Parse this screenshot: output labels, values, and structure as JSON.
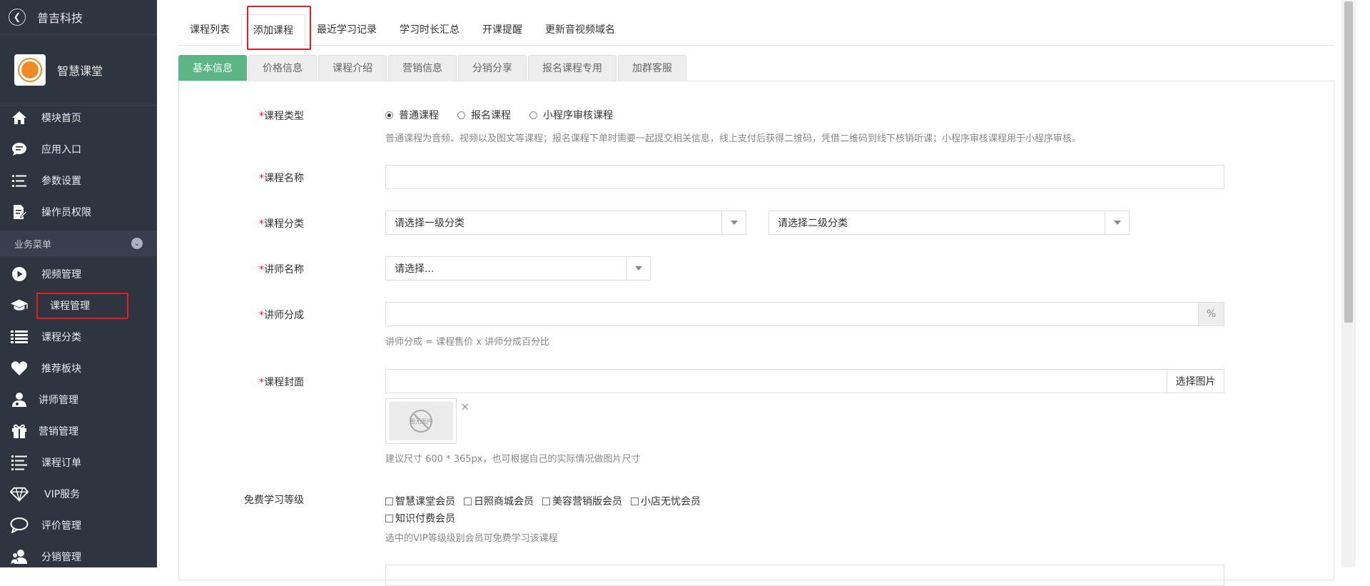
{
  "app": {
    "title": "普吉科技",
    "module_name": "智慧课堂"
  },
  "sidebar": {
    "top_items": [
      {
        "label": "模块首页",
        "icon": "home-icon"
      },
      {
        "label": "应用入口",
        "icon": "chat-icon"
      },
      {
        "label": "参数设置",
        "icon": "list-settings-icon"
      },
      {
        "label": "操作员权限",
        "icon": "edit-doc-icon"
      }
    ],
    "section_label": "业务菜单",
    "business_items": [
      {
        "label": "视频管理",
        "icon": "play-icon"
      },
      {
        "label": "课程管理",
        "icon": "graduation-cap-icon"
      },
      {
        "label": "课程分类",
        "icon": "list-icon"
      },
      {
        "label": "推荐板块",
        "icon": "heart-icon"
      },
      {
        "label": "讲师管理",
        "icon": "teacher-icon"
      },
      {
        "label": "营销管理",
        "icon": "gift-icon"
      },
      {
        "label": "课程订单",
        "icon": "order-list-icon"
      },
      {
        "label": "VIP服务",
        "icon": "diamond-icon"
      },
      {
        "label": "评价管理",
        "icon": "comment-icon"
      },
      {
        "label": "分销管理",
        "icon": "users-icon"
      }
    ],
    "active_item": "课程管理"
  },
  "top_tabs": [
    {
      "label": "课程列表"
    },
    {
      "label": "添加课程"
    },
    {
      "label": "最近学习记录"
    },
    {
      "label": "学习时长汇总"
    },
    {
      "label": "开课提醒"
    },
    {
      "label": "更新音视频域名"
    }
  ],
  "sub_tabs": [
    {
      "label": "基本信息"
    },
    {
      "label": "价格信息"
    },
    {
      "label": "课程介绍"
    },
    {
      "label": "营销信息"
    },
    {
      "label": "分销分享"
    },
    {
      "label": "报名课程专用"
    },
    {
      "label": "加群客服"
    }
  ],
  "form": {
    "required_mark": "*",
    "course_type": {
      "label": "课程类型",
      "options": [
        "普通课程",
        "报名课程",
        "小程序审核课程"
      ],
      "selected": "普通课程",
      "hint": "普通课程为音频、视频以及图文等课程；报名课程下单时需要一起提交相关信息，线上支付后获得二维码，凭借二维码到线下核销听课；小程序审核课程用于小程序审核。"
    },
    "course_name": {
      "label": "课程名称",
      "value": ""
    },
    "category": {
      "label": "课程分类",
      "first_placeholder": "请选择一级分类",
      "second_placeholder": "请选择二级分类"
    },
    "teacher": {
      "label": "讲师名称",
      "placeholder": "请选择..."
    },
    "teacher_share": {
      "label": "讲师分成",
      "value": "",
      "unit": "%",
      "hint": "讲师分成 = 课程售价 x 讲师分成百分比"
    },
    "cover": {
      "label": "课程封面",
      "value": "",
      "button": "选择图片",
      "no_image_text": "暂无图片",
      "remove": "×",
      "hint": "建议尺寸 600 * 365px，也可根据自己的实际情况做图片尺寸"
    },
    "free_level": {
      "label": "免费学习等级",
      "options": [
        "智慧课堂会员",
        "日照商城会员",
        "美容营销版会员",
        "小店无忧会员",
        "知识付费会员"
      ],
      "hint": "选中的VIP等级级别会员可免费学习该课程"
    }
  }
}
